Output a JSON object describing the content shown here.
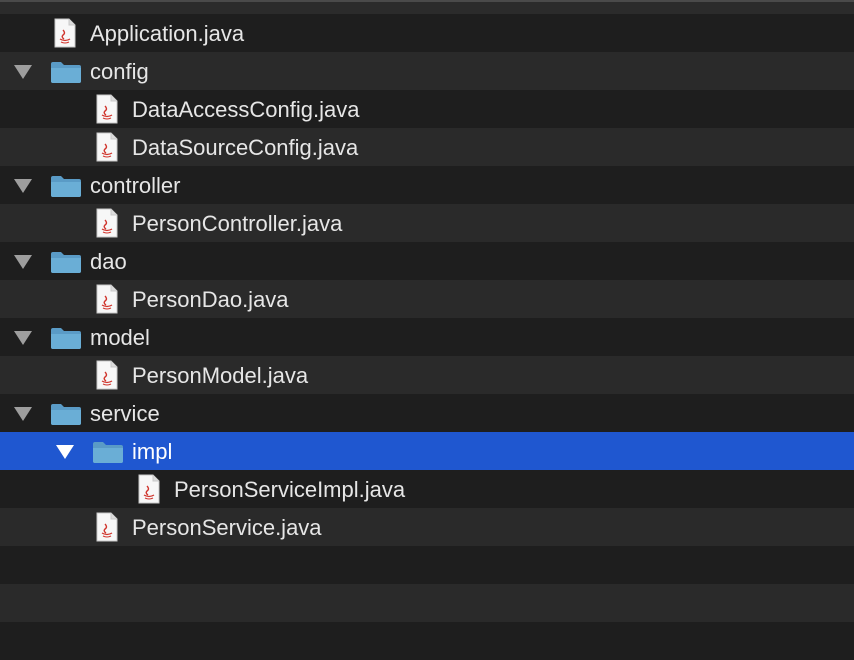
{
  "tree": {
    "items": [
      {
        "label": "Application.java",
        "type": "file",
        "depth": 0,
        "expanded": false,
        "selected": false
      },
      {
        "label": "config",
        "type": "folder",
        "depth": 0,
        "expanded": true,
        "selected": false
      },
      {
        "label": "DataAccessConfig.java",
        "type": "file",
        "depth": 1,
        "expanded": false,
        "selected": false
      },
      {
        "label": "DataSourceConfig.java",
        "type": "file",
        "depth": 1,
        "expanded": false,
        "selected": false
      },
      {
        "label": "controller",
        "type": "folder",
        "depth": 0,
        "expanded": true,
        "selected": false
      },
      {
        "label": "PersonController.java",
        "type": "file",
        "depth": 1,
        "expanded": false,
        "selected": false
      },
      {
        "label": "dao",
        "type": "folder",
        "depth": 0,
        "expanded": true,
        "selected": false
      },
      {
        "label": "PersonDao.java",
        "type": "file",
        "depth": 1,
        "expanded": false,
        "selected": false
      },
      {
        "label": "model",
        "type": "folder",
        "depth": 0,
        "expanded": true,
        "selected": false
      },
      {
        "label": "PersonModel.java",
        "type": "file",
        "depth": 1,
        "expanded": false,
        "selected": false
      },
      {
        "label": "service",
        "type": "folder",
        "depth": 0,
        "expanded": true,
        "selected": false
      },
      {
        "label": "impl",
        "type": "folder",
        "depth": 1,
        "expanded": true,
        "selected": true
      },
      {
        "label": "PersonServiceImpl.java",
        "type": "file",
        "depth": 2,
        "expanded": false,
        "selected": false
      },
      {
        "label": "PersonService.java",
        "type": "file",
        "depth": 1,
        "expanded": false,
        "selected": false
      }
    ]
  },
  "colors": {
    "selection": "#1f57d0",
    "folder": "#6aaed6",
    "background": "#1e1e1e",
    "stripe": "#2a2a2a"
  },
  "icons": {
    "folder": "folder-icon",
    "file": "java-file-icon",
    "disclosure": "disclosure-triangle-icon"
  }
}
